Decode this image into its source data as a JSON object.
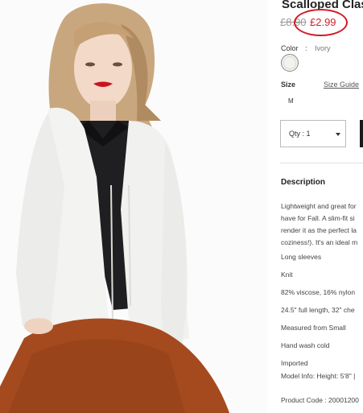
{
  "product": {
    "title": "Scalloped Clas",
    "old_price": "£8.90",
    "sale_price": "£2.99"
  },
  "color": {
    "label": "Color",
    "separator": ":",
    "value": "Ivory"
  },
  "size": {
    "label": "Size",
    "guide_label": "Size Guide",
    "selected": "M"
  },
  "quantity": {
    "label": "Qty : 1"
  },
  "description": {
    "title": "Description",
    "lines": [
      "Lightweight and great for",
      "have for Fall. A slim-fit si",
      "render it as the perfect la",
      "coziness!). It's an ideal m"
    ],
    "details": [
      "Long sleeves",
      "Knit",
      "82% viscose, 16% nylon",
      "24.5\" full length, 32\" che",
      "Measured from Small",
      "Hand wash cold",
      "Imported",
      "Model Info: Height: 5'8\" |",
      "Product Code : 20001200"
    ]
  },
  "colors": {
    "sale": "#d0202a",
    "annotation_circle": "#d21a22"
  }
}
